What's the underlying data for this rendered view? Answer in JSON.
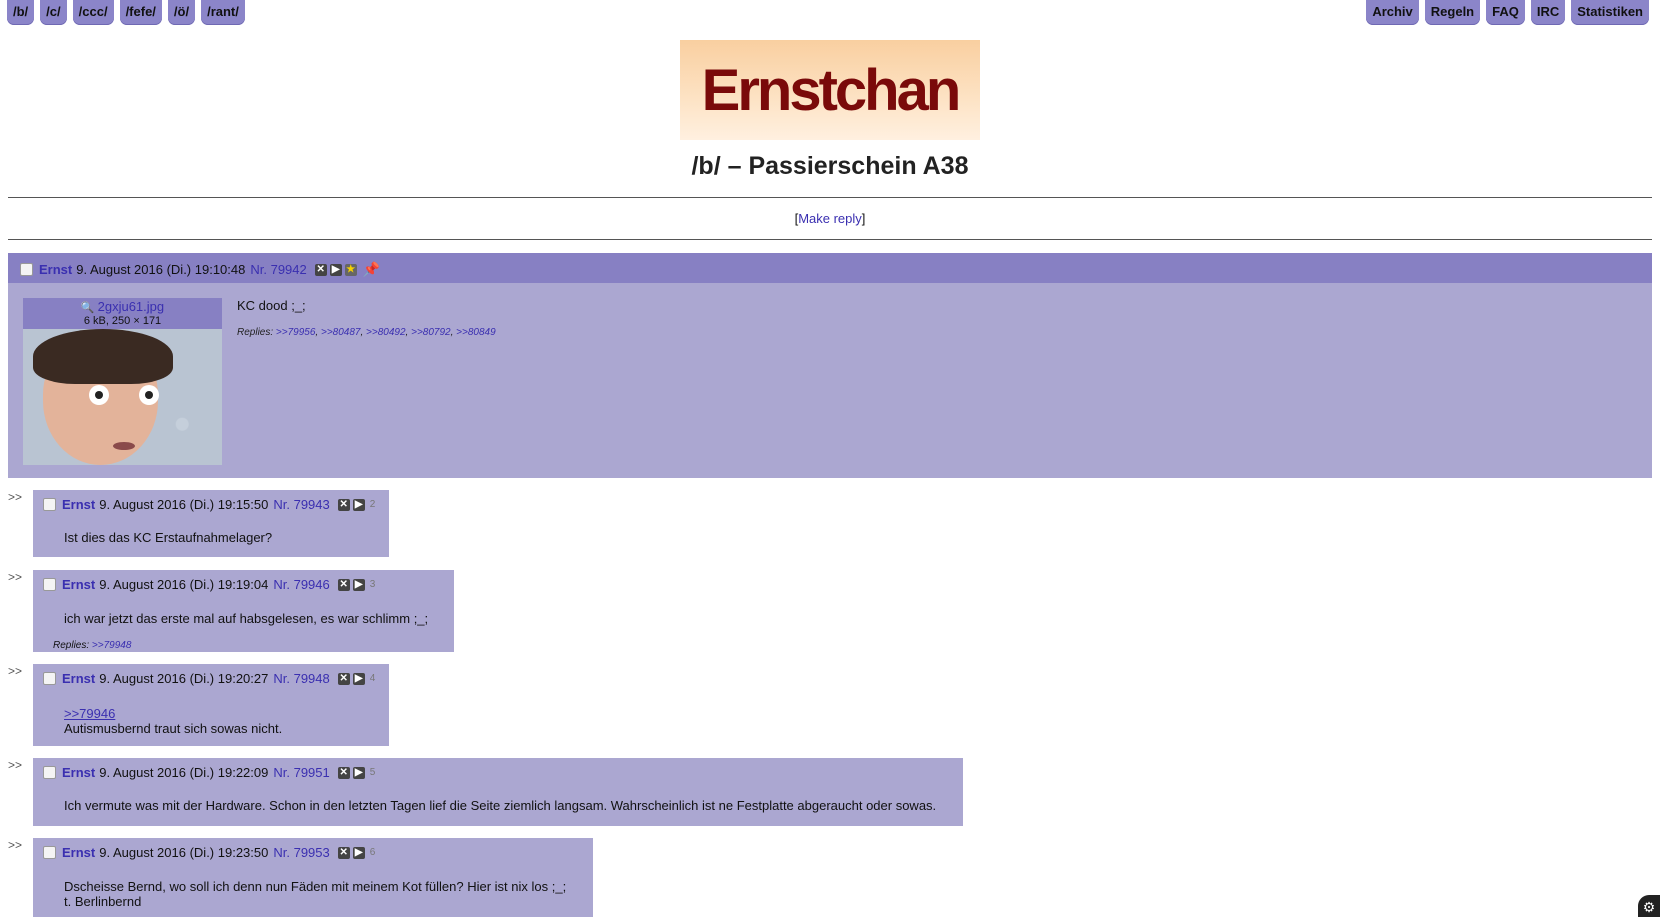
{
  "nav": {
    "left": [
      "/b/",
      "/c/",
      "/ccc/",
      "/fefe/",
      "/ö/",
      "/rant/"
    ],
    "right": [
      "Archiv",
      "Regeln",
      "FAQ",
      "IRC",
      "Statistiken"
    ]
  },
  "logo_text": "Ernstchan",
  "board_title": "/b/ – Passierschein A38",
  "make_reply": "Make reply",
  "op": {
    "name": "Ernst",
    "date": "9. August 2016 (Di.) 19:10:48",
    "nr": "Nr. 79942",
    "file_name": "2gxju61.jpg",
    "file_meta": "6 kB, 250 × 171",
    "text": "KC dood ;_;",
    "replies_label": "Replies:",
    "replies": [
      ">>79956",
      ">>80487",
      ">>80492",
      ">>80792",
      ">>80849"
    ]
  },
  "replies": [
    {
      "name": "Ernst",
      "date": "9. August 2016 (Di.) 19:15:50",
      "nr": "Nr. 79943",
      "num": "2",
      "quote": "",
      "text": "Ist dies das KC Erstaufnahmelager?",
      "text2": "",
      "replies": ""
    },
    {
      "name": "Ernst",
      "date": "9. August 2016 (Di.) 19:19:04",
      "nr": "Nr. 79946",
      "num": "3",
      "quote": "",
      "text": "ich war jetzt das erste mal auf habsgelesen, es war schlimm ;_;",
      "text2": "",
      "replies": ">>79948"
    },
    {
      "name": "Ernst",
      "date": "9. August 2016 (Di.) 19:20:27",
      "nr": "Nr. 79948",
      "num": "4",
      "quote": ">>79946",
      "text": "Autismusbernd traut sich sowas nicht.",
      "text2": "",
      "replies": ""
    },
    {
      "name": "Ernst",
      "date": "9. August 2016 (Di.) 19:22:09",
      "nr": "Nr. 79951",
      "num": "5",
      "quote": "",
      "text": "Ich vermute was mit der Hardware. Schon in den letzten Tagen lief die Seite ziemlich langsam. Wahrscheinlich ist ne Festplatte abgeraucht oder sowas.",
      "text2": "",
      "replies": ""
    },
    {
      "name": "Ernst",
      "date": "9. August 2016 (Di.) 19:23:50",
      "nr": "Nr. 79953",
      "num": "6",
      "quote": "",
      "text": "Dscheisse Bernd, wo soll ich denn nun Fäden mit meinem Kot füllen? Hier ist nix los ;_;",
      "text2": "t. Berlinbernd",
      "replies": ""
    }
  ],
  "arrows": ">>",
  "replies_label": "Replies:"
}
